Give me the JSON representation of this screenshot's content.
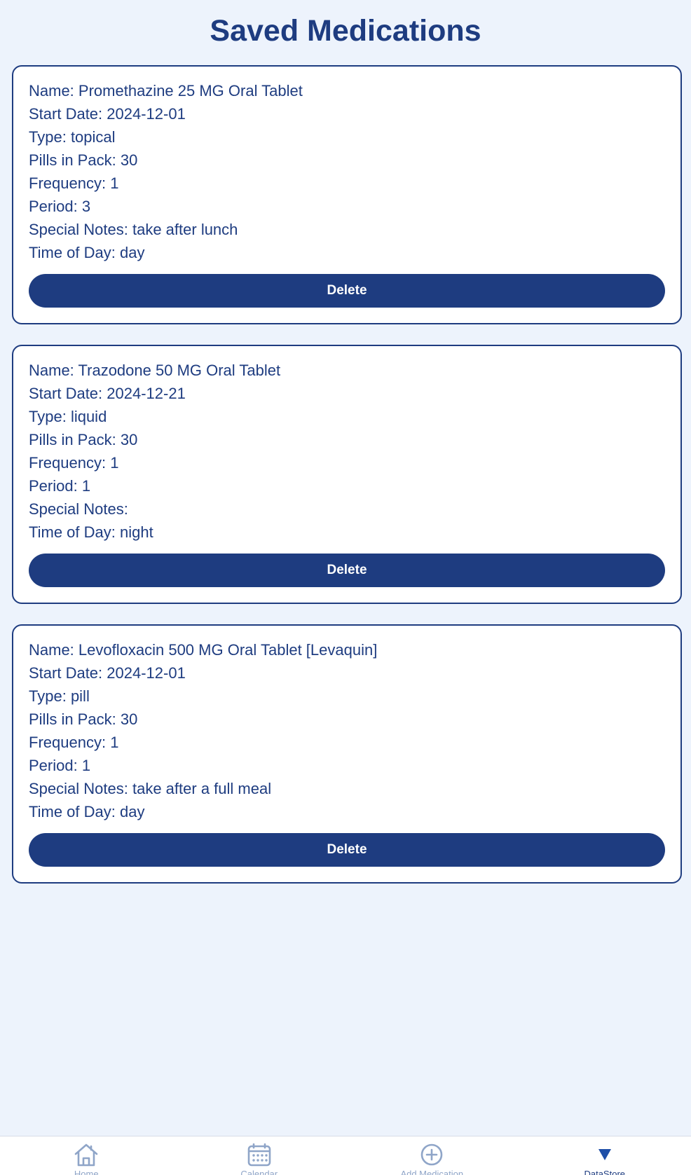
{
  "page": {
    "title": "Saved Medications"
  },
  "colors": {
    "background": "#edf3fc",
    "accent": "#1e3c80",
    "card": "#ffffff",
    "tab_inactive": "#8fa5c8"
  },
  "medications": [
    {
      "fields": [
        {
          "label": "Name:",
          "value": "Promethazine 25 MG Oral Tablet"
        },
        {
          "label": "Start Date:",
          "value": "2024-12-01"
        },
        {
          "label": "Type:",
          "value": "topical"
        },
        {
          "label": "Pills in Pack:",
          "value": "30"
        },
        {
          "label": "Frequency:",
          "value": "1"
        },
        {
          "label": "Period:",
          "value": "3"
        },
        {
          "label": "Special Notes:",
          "value": "take after lunch"
        },
        {
          "label": "Time of Day:",
          "value": "day"
        }
      ],
      "delete_label": "Delete"
    },
    {
      "fields": [
        {
          "label": "Name:",
          "value": "Trazodone 50 MG Oral Tablet"
        },
        {
          "label": "Start Date:",
          "value": "2024-12-21"
        },
        {
          "label": "Type:",
          "value": "liquid"
        },
        {
          "label": "Pills in Pack:",
          "value": "30"
        },
        {
          "label": "Frequency:",
          "value": "1"
        },
        {
          "label": "Period:",
          "value": "1"
        },
        {
          "label": "Special Notes:",
          "value": ""
        },
        {
          "label": "Time of Day:",
          "value": "night"
        }
      ],
      "delete_label": "Delete"
    },
    {
      "fields": [
        {
          "label": "Name:",
          "value": "Levofloxacin 500 MG Oral Tablet [Levaquin]"
        },
        {
          "label": "Start Date:",
          "value": "2024-12-01"
        },
        {
          "label": "Type:",
          "value": "pill"
        },
        {
          "label": "Pills in Pack:",
          "value": "30"
        },
        {
          "label": "Frequency:",
          "value": "1"
        },
        {
          "label": "Period:",
          "value": "1"
        },
        {
          "label": "Special Notes:",
          "value": "take after a full meal"
        },
        {
          "label": "Time of Day:",
          "value": "day"
        }
      ],
      "delete_label": "Delete"
    }
  ],
  "tabbar": {
    "tabs": [
      {
        "label": "Home",
        "icon": "home-icon",
        "active": false
      },
      {
        "label": "Calendar",
        "icon": "calendar-icon",
        "active": false
      },
      {
        "label": "Add Medication",
        "icon": "plus-circle-icon",
        "active": false
      },
      {
        "label": "DataStore",
        "icon": "triangle-down-icon",
        "active": true
      }
    ]
  }
}
